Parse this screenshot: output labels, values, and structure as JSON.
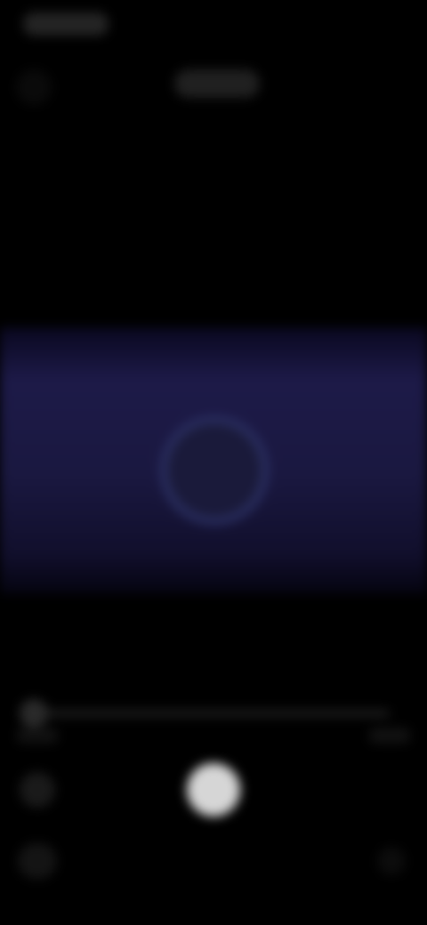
{
  "status_bar": {
    "time": ""
  },
  "header": {
    "title": ""
  },
  "player": {
    "state": "loading",
    "progress_fraction": 0,
    "time_current": "",
    "time_total": ""
  },
  "colors": {
    "background": "#000000",
    "media_background": "#1d1a48",
    "spinner_ring": "#2b3063",
    "play_button": "#d6d6d6"
  },
  "icons": {
    "back": "back-arrow-icon",
    "loading": "loading-spinner-icon",
    "play": "play-icon",
    "left_control": "settings-icon",
    "bottom_left": "mute-icon",
    "bottom_right": "fullscreen-icon"
  }
}
